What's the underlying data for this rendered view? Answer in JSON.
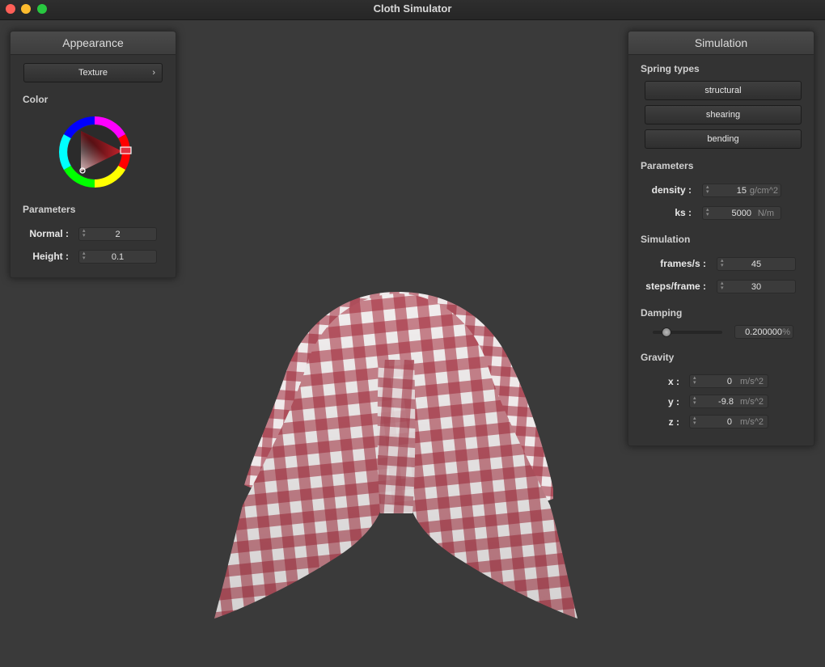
{
  "window": {
    "title": "Cloth Simulator"
  },
  "appearance": {
    "title": "Appearance",
    "texture_label": "Texture",
    "texture_chevron": "›",
    "color_label": "Color",
    "parameters_label": "Parameters",
    "normal_label": "Normal :",
    "normal_value": "2",
    "height_label": "Height :",
    "height_value": "0.1"
  },
  "simulation": {
    "title": "Simulation",
    "spring_types_label": "Spring types",
    "spring_buttons": [
      "structural",
      "shearing",
      "bending"
    ],
    "parameters_label": "Parameters",
    "density_label": "density :",
    "density_value": "15",
    "density_unit": "g/cm^2",
    "ks_label": "ks :",
    "ks_value": "5000",
    "ks_unit": "N/m",
    "simulation_label": "Simulation",
    "fps_label": "frames/s :",
    "fps_value": "45",
    "steps_label": "steps/frame :",
    "steps_value": "30",
    "damping_label": "Damping",
    "damping_value": "0.200000",
    "damping_unit": "%",
    "damping_slider_level": 0.2,
    "gravity_label": "Gravity",
    "gx_label": "x :",
    "gx_value": "0",
    "gy_label": "y :",
    "gy_value": "-9.8",
    "gz_label": "z :",
    "gz_value": "0",
    "gravity_unit": "m/s^2"
  },
  "colors": {
    "background": "#3a3a3a",
    "cloth_red": "#a3293a",
    "cloth_white": "#f1eeee",
    "selected_color": "#c4232c"
  },
  "icons": {
    "spinner": "updown-arrows-icon",
    "chevron": "chevron-right-icon"
  }
}
